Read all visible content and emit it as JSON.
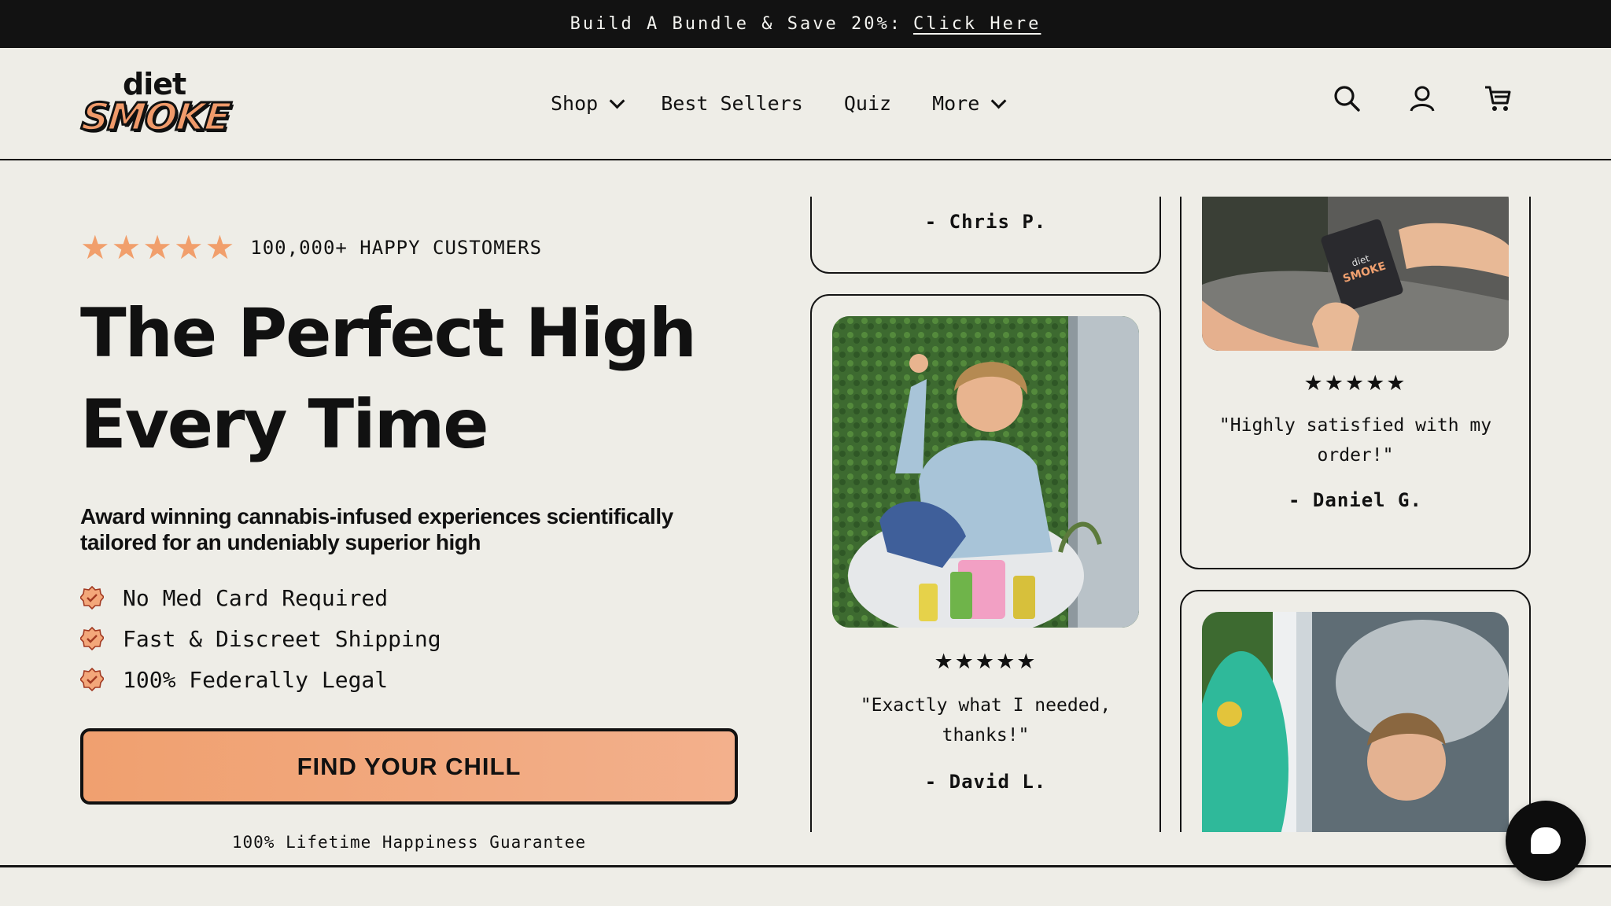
{
  "announcement": {
    "text": "Build A Bundle & Save 20%:",
    "link": "Click Here"
  },
  "header": {
    "logo_top": "diet",
    "logo_main": "SMOKE",
    "nav": [
      {
        "label": "Shop",
        "dropdown": true
      },
      {
        "label": "Best Sellers",
        "dropdown": false
      },
      {
        "label": "Quiz",
        "dropdown": false
      },
      {
        "label": "More",
        "dropdown": true
      }
    ],
    "icons": [
      "search-icon",
      "account-icon",
      "cart-icon"
    ]
  },
  "hero": {
    "stars": "★★★★★",
    "rating_text": "100,000+ HAPPY CUSTOMERS",
    "headline_line1": "The Perfect High",
    "headline_line2": "Every Time",
    "subhead": "Award winning cannabis-infused experiences scientifically tailored for an undeniably superior high",
    "benefits": [
      "No Med Card Required",
      "Fast & Discreet Shipping",
      "100% Federally Legal"
    ],
    "cta": "FIND YOUR CHILL",
    "guarantee": "100% Lifetime Happiness Guarantee"
  },
  "reviews": [
    {
      "author": "- Chris P."
    },
    {
      "stars": "★★★★★",
      "quote": "\"Exactly what I needed, thanks!\"",
      "author": "- David L."
    },
    {
      "stars": "★★★★★",
      "quote": "\"Highly satisfied with my order!\"",
      "author": "- Daniel G."
    }
  ],
  "colors": {
    "accent": "#f0a06f",
    "background": "#eeede7",
    "dark": "#121212"
  }
}
